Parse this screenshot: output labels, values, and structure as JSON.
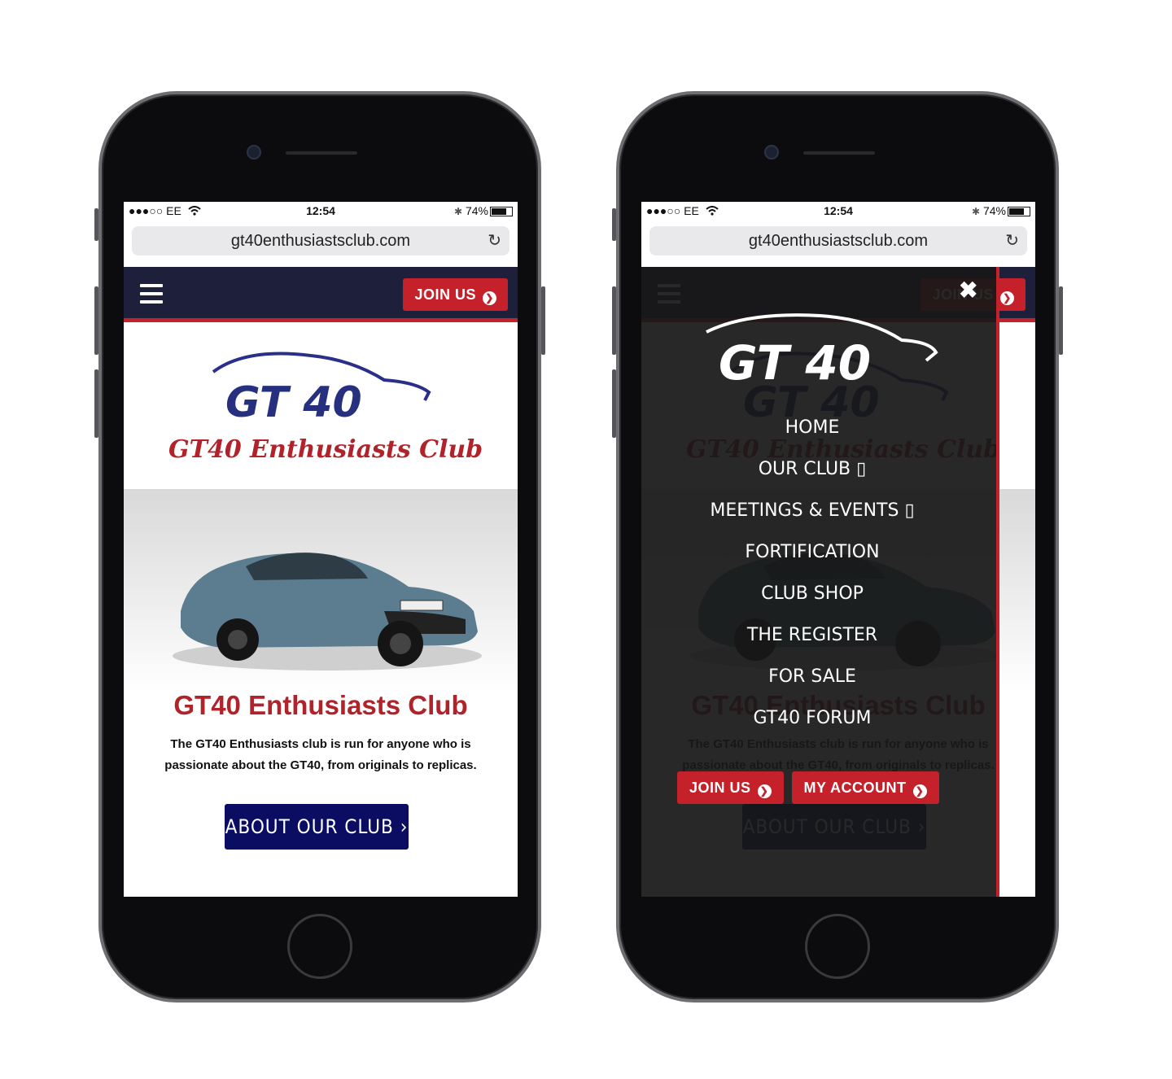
{
  "status_bar": {
    "carrier": "●●●○○ EE",
    "wifi_icon": "wifi-icon",
    "time": "12:54",
    "battery": "74%",
    "bluetooth": "✱"
  },
  "browser": {
    "url": "gt40enthusiastsclub.com",
    "reload": "↻"
  },
  "nav": {
    "join_label": "JOIN US"
  },
  "logo": {
    "line1": "GT 40",
    "line2": "GT40 Enthusiasts Club"
  },
  "hero": {
    "title": "GT40 Enthusiasts Club",
    "description": "The GT40 Enthusiasts club is run for anyone who is passionate about the GT40, from originals to replicas.",
    "button": "ABOUT OUR CLUB ›"
  },
  "menu": {
    "close": "✖",
    "logo_text": "GT 40",
    "items": [
      {
        "label": "HOME"
      },
      {
        "label": "OUR CLUB ▯"
      },
      {
        "label": "MEETINGS & EVENTS ▯"
      },
      {
        "label": "FORTIFICATION"
      },
      {
        "label": "CLUB SHOP"
      },
      {
        "label": "THE REGISTER"
      },
      {
        "label": "FOR SALE"
      },
      {
        "label": "GT40 FORUM"
      }
    ],
    "join_label": "JOIN US",
    "account_label": "MY ACCOUNT"
  },
  "colors": {
    "navy": "#1d1f3b",
    "red": "#c4212b",
    "button_blue": "#0b0d63"
  }
}
